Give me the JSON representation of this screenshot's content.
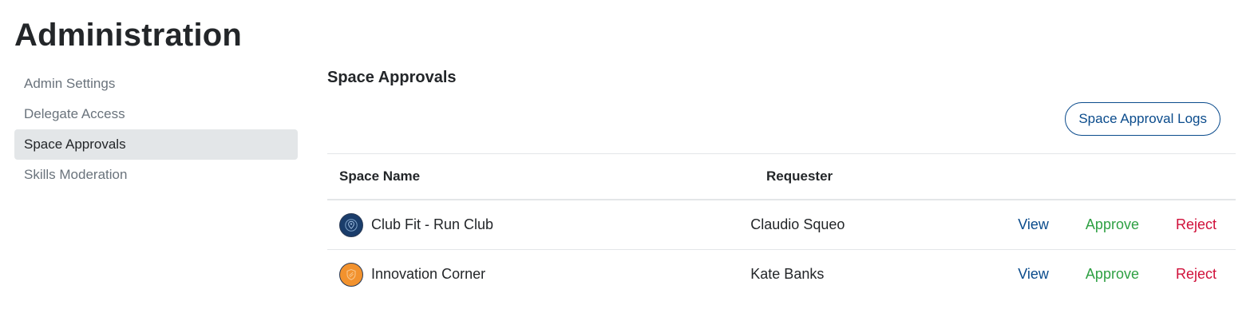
{
  "page": {
    "title": "Administration"
  },
  "sidebar": {
    "items": [
      {
        "label": "Admin Settings",
        "active": false
      },
      {
        "label": "Delegate Access",
        "active": false
      },
      {
        "label": "Space Approvals",
        "active": true
      },
      {
        "label": "Skills Moderation",
        "active": false
      }
    ]
  },
  "main": {
    "section_title": "Space Approvals",
    "logs_button_label": "Space Approval Logs",
    "table": {
      "headers": {
        "space_name": "Space Name",
        "requester": "Requester"
      },
      "rows": [
        {
          "space_name": "Club Fit - Run Club",
          "requester": "Claudio Squeo",
          "avatar_color": "#1a3d6b",
          "avatar_icon": "map-pin-icon",
          "view_label": "View",
          "approve_label": "Approve",
          "reject_label": "Reject"
        },
        {
          "space_name": "Innovation Corner",
          "requester": "Kate Banks",
          "avatar_color": "#f2922e",
          "avatar_icon": "badge-icon",
          "view_label": "View",
          "approve_label": "Approve",
          "reject_label": "Reject"
        }
      ]
    }
  },
  "colors": {
    "link": "#0a4b8c",
    "approve": "#2ea043",
    "reject": "#d0103a",
    "active_bg": "#e3e6e8"
  }
}
